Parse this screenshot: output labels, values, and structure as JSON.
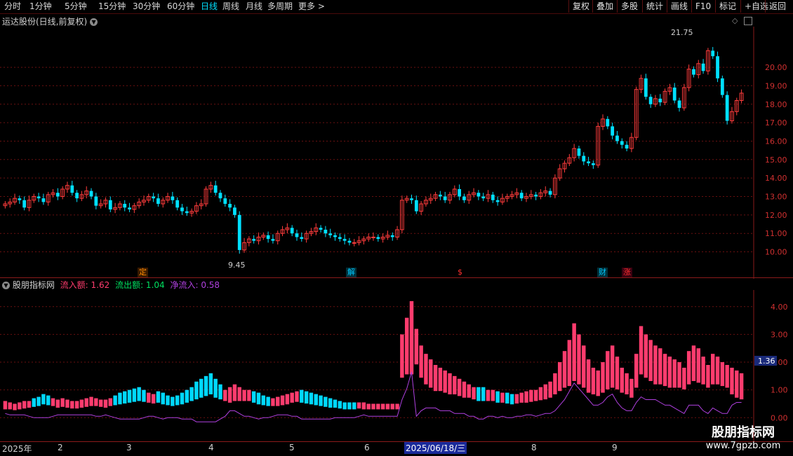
{
  "toolbar": {
    "periods": [
      "分时",
      "1分钟",
      "5分钟",
      "15分钟",
      "30分钟",
      "60分钟",
      "日线",
      "周线",
      "月线",
      "多周期",
      "更多 >"
    ],
    "active_period": "日线",
    "buttons": [
      "复权",
      "叠加",
      "多股",
      "统计",
      "画线",
      "F10",
      "标记",
      "+自选",
      "返回"
    ]
  },
  "main_chart": {
    "title": "运达股份(日线,前复权)",
    "max_label": "21.75",
    "min_label": "9.45",
    "y_ticks": [
      20.0,
      19.0,
      18.0,
      17.0,
      16.0,
      15.0,
      14.0,
      13.0,
      12.0,
      11.0,
      10.0
    ],
    "event_tags": [
      {
        "text": "定",
        "color": "#ff8c00"
      },
      {
        "text": "解",
        "color": "#00c8ff"
      },
      {
        "text": "$",
        "color": "#ff3030"
      },
      {
        "text": "财",
        "color": "#00c8ff"
      },
      {
        "text": "涨",
        "color": "#ff3030"
      }
    ]
  },
  "indicator": {
    "name": "股朋指标网",
    "inflow_label": "流入额: 1.62",
    "outflow_label": "流出额: 1.04",
    "net_label": "净流入: 0.58",
    "inflow_color": "#ff3c6e",
    "outflow_color": "#00d8ff",
    "net_color": "#b040e0",
    "y_ticks": [
      4.0,
      3.0,
      2.0,
      1.0,
      0.0
    ],
    "current_value": "1.36"
  },
  "x_axis": {
    "labels": [
      "2025年",
      "2",
      "3",
      "4",
      "5",
      "6",
      "8",
      "9"
    ],
    "cursor_date": "2025/06/18/三"
  },
  "watermark": {
    "title": "股朋指标网",
    "url": "www.7gpzb.com"
  },
  "chart_data": {
    "type": "candlestick",
    "main_range": [
      9.3,
      21.9
    ],
    "closes": [
      12.6,
      12.7,
      12.9,
      12.8,
      12.4,
      12.8,
      13.0,
      12.9,
      12.7,
      13.1,
      13.2,
      13.0,
      13.4,
      13.6,
      13.2,
      12.9,
      13.1,
      13.3,
      13.0,
      12.5,
      12.6,
      12.8,
      12.3,
      12.4,
      12.6,
      12.4,
      12.3,
      12.5,
      12.7,
      12.8,
      13.0,
      12.9,
      12.6,
      12.8,
      13.0,
      12.8,
      12.4,
      12.2,
      12.1,
      12.2,
      12.5,
      12.6,
      13.4,
      13.6,
      13.2,
      12.9,
      12.6,
      12.4,
      12.0,
      10.1,
      10.5,
      10.7,
      10.6,
      10.8,
      10.9,
      10.7,
      10.6,
      11.0,
      11.2,
      11.3,
      11.0,
      10.8,
      10.7,
      11.0,
      11.1,
      11.3,
      11.2,
      11.0,
      10.9,
      10.8,
      10.7,
      10.6,
      10.5,
      10.5,
      10.6,
      10.7,
      10.8,
      10.8,
      10.7,
      10.8,
      10.9,
      10.8,
      11.2,
      12.8,
      12.9,
      12.8,
      12.2,
      12.6,
      12.8,
      12.9,
      13.1,
      13.0,
      12.8,
      13.1,
      13.4,
      13.0,
      12.8,
      13.1,
      13.2,
      13.0,
      12.9,
      13.1,
      12.8,
      12.7,
      12.9,
      13.0,
      13.1,
      13.2,
      12.9,
      13.0,
      13.1,
      13.0,
      13.2,
      13.3,
      13.1,
      14.0,
      14.5,
      14.8,
      15.1,
      15.6,
      15.2,
      14.9,
      14.8,
      14.7,
      16.8,
      17.2,
      16.8,
      16.3,
      16.0,
      15.8,
      15.6,
      16.2,
      18.8,
      19.4,
      18.4,
      18.0,
      18.3,
      18.1,
      18.7,
      18.9,
      18.2,
      17.8,
      18.9,
      19.9,
      19.6,
      20.2,
      19.8,
      20.9,
      20.6,
      19.4,
      18.5,
      17.1,
      17.6,
      18.2,
      18.6
    ],
    "inflow": [
      0.6,
      0.55,
      0.5,
      0.55,
      0.6,
      0.6,
      0.65,
      0.7,
      0.8,
      0.75,
      0.7,
      0.65,
      0.7,
      0.65,
      0.6,
      0.6,
      0.65,
      0.7,
      0.75,
      0.7,
      0.65,
      0.65,
      0.7,
      0.75,
      0.8,
      0.85,
      0.9,
      0.95,
      1.0,
      0.95,
      0.9,
      0.85,
      0.9,
      0.8,
      0.75,
      0.7,
      0.75,
      0.8,
      0.9,
      1.0,
      1.1,
      1.2,
      1.3,
      1.4,
      1.2,
      1.1,
      1.0,
      1.1,
      1.2,
      1.1,
      1.0,
      1.0,
      0.9,
      0.8,
      0.75,
      0.7,
      0.7,
      0.75,
      0.8,
      0.85,
      0.9,
      0.95,
      0.9,
      0.85,
      0.8,
      0.75,
      0.7,
      0.65,
      0.6,
      0.6,
      0.55,
      0.5,
      0.5,
      0.5,
      0.55,
      0.55,
      0.5,
      0.5,
      0.5,
      0.5,
      0.5,
      0.5,
      0.5,
      3.0,
      3.6,
      4.2,
      3.2,
      2.6,
      2.3,
      2.1,
      1.9,
      1.8,
      1.7,
      1.6,
      1.5,
      1.4,
      1.3,
      1.2,
      1.1,
      1.0,
      1.0,
      1.0,
      1.0,
      0.9,
      0.9,
      0.85,
      0.8,
      0.85,
      0.9,
      0.95,
      1.0,
      1.0,
      1.1,
      1.2,
      1.3,
      1.6,
      2.0,
      2.4,
      2.8,
      3.4,
      3.0,
      2.6,
      2.1,
      1.8,
      1.7,
      2.0,
      2.4,
      2.6,
      2.2,
      1.8,
      1.6,
      1.4,
      2.3,
      3.3,
      3.0,
      2.8,
      2.6,
      2.5,
      2.3,
      2.2,
      2.1,
      2.0,
      1.8,
      2.4,
      2.6,
      2.5,
      2.2,
      1.9,
      2.3,
      2.2,
      2.0,
      1.9,
      1.8,
      1.7,
      1.6
    ],
    "outflow": [
      0.5,
      0.5,
      0.45,
      0.5,
      0.55,
      0.6,
      0.7,
      0.75,
      0.85,
      0.8,
      0.7,
      0.6,
      0.65,
      0.6,
      0.55,
      0.55,
      0.6,
      0.65,
      0.7,
      0.7,
      0.65,
      0.6,
      0.7,
      0.8,
      0.9,
      0.95,
      1.0,
      1.05,
      1.1,
      1.0,
      0.9,
      0.85,
      0.95,
      0.9,
      0.8,
      0.75,
      0.8,
      0.9,
      1.0,
      1.1,
      1.3,
      1.4,
      1.5,
      1.6,
      1.4,
      1.2,
      1.0,
      0.9,
      1.0,
      1.0,
      1.0,
      1.0,
      0.95,
      0.9,
      0.8,
      0.75,
      0.7,
      0.7,
      0.75,
      0.8,
      0.9,
      0.95,
      1.0,
      0.95,
      0.9,
      0.85,
      0.8,
      0.75,
      0.7,
      0.65,
      0.6,
      0.55,
      0.55,
      0.55,
      0.55,
      0.5,
      0.5,
      0.5,
      0.5,
      0.5,
      0.5,
      0.5,
      0.5,
      2.4,
      2.6,
      2.6,
      3.2,
      2.4,
      2.0,
      1.8,
      1.6,
      1.6,
      1.5,
      1.4,
      1.4,
      1.3,
      1.2,
      1.2,
      1.1,
      1.1,
      1.1,
      1.0,
      1.0,
      0.95,
      0.9,
      0.9,
      0.85,
      0.85,
      0.9,
      0.9,
      0.95,
      1.0,
      1.05,
      1.1,
      1.2,
      1.4,
      1.6,
      1.8,
      1.9,
      2.2,
      2.0,
      1.8,
      1.5,
      1.4,
      1.3,
      1.5,
      1.7,
      1.8,
      1.7,
      1.5,
      1.4,
      1.2,
      1.8,
      2.6,
      2.4,
      2.2,
      2.0,
      2.0,
      1.9,
      1.8,
      1.8,
      1.8,
      1.7,
      2.0,
      2.2,
      2.1,
      2.0,
      1.8,
      2.0,
      2.0,
      1.9,
      1.8,
      1.4,
      1.2,
      1.1
    ]
  }
}
